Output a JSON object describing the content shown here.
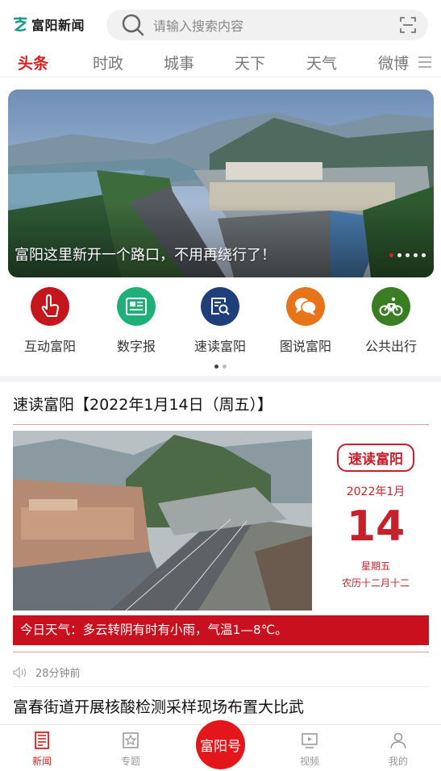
{
  "header": {
    "logo_text": "富阳新闻",
    "search_placeholder": "请输入搜索内容"
  },
  "tabs": [
    {
      "label": "头条",
      "active": true
    },
    {
      "label": "时政",
      "active": false
    },
    {
      "label": "城事",
      "active": false
    },
    {
      "label": "天下",
      "active": false
    },
    {
      "label": "天气",
      "active": false
    },
    {
      "label": "微博",
      "active": false
    }
  ],
  "banner": {
    "caption": "富阳这里新开一个路口，不用再绕行了！",
    "dot_count": 5,
    "active_dot": 0
  },
  "shortcuts": [
    {
      "label": "互动富阳",
      "icon": "touch-icon",
      "color": "#c4161c"
    },
    {
      "label": "数字报",
      "icon": "newspaper-icon",
      "color": "#1fb07a"
    },
    {
      "label": "速读富阳",
      "icon": "reader-search-icon",
      "color": "#1e3f7a"
    },
    {
      "label": "图说富阳",
      "icon": "chat-bubble-icon",
      "color": "#e8741a"
    },
    {
      "label": "公共出行",
      "icon": "bicycle-icon",
      "color": "#3a7d22"
    }
  ],
  "article": {
    "title": "速读富阳【2022年1月14日（周五）】",
    "badge": "速读富阳",
    "month": "2022年1月",
    "day": "14",
    "weekday": "星期五",
    "lunar": "农历十二月十二",
    "weather": "今日天气：多云转阴有时有小雨，气温1—8℃。",
    "time_ago": "28分钟前"
  },
  "next_article": {
    "title": "富春街道开展核酸检测采样现场布置大比武"
  },
  "bottom_nav": {
    "items": [
      {
        "label": "新闻",
        "icon": "news-icon",
        "active": true
      },
      {
        "label": "专题",
        "icon": "topic-icon",
        "active": false
      },
      {
        "label": "视频",
        "icon": "video-icon",
        "active": false
      },
      {
        "label": "我的",
        "icon": "user-icon",
        "active": false
      }
    ],
    "center_label": "富阳号"
  },
  "colors": {
    "accent": "#d81e1e",
    "weather_bar": "#c8101e"
  }
}
